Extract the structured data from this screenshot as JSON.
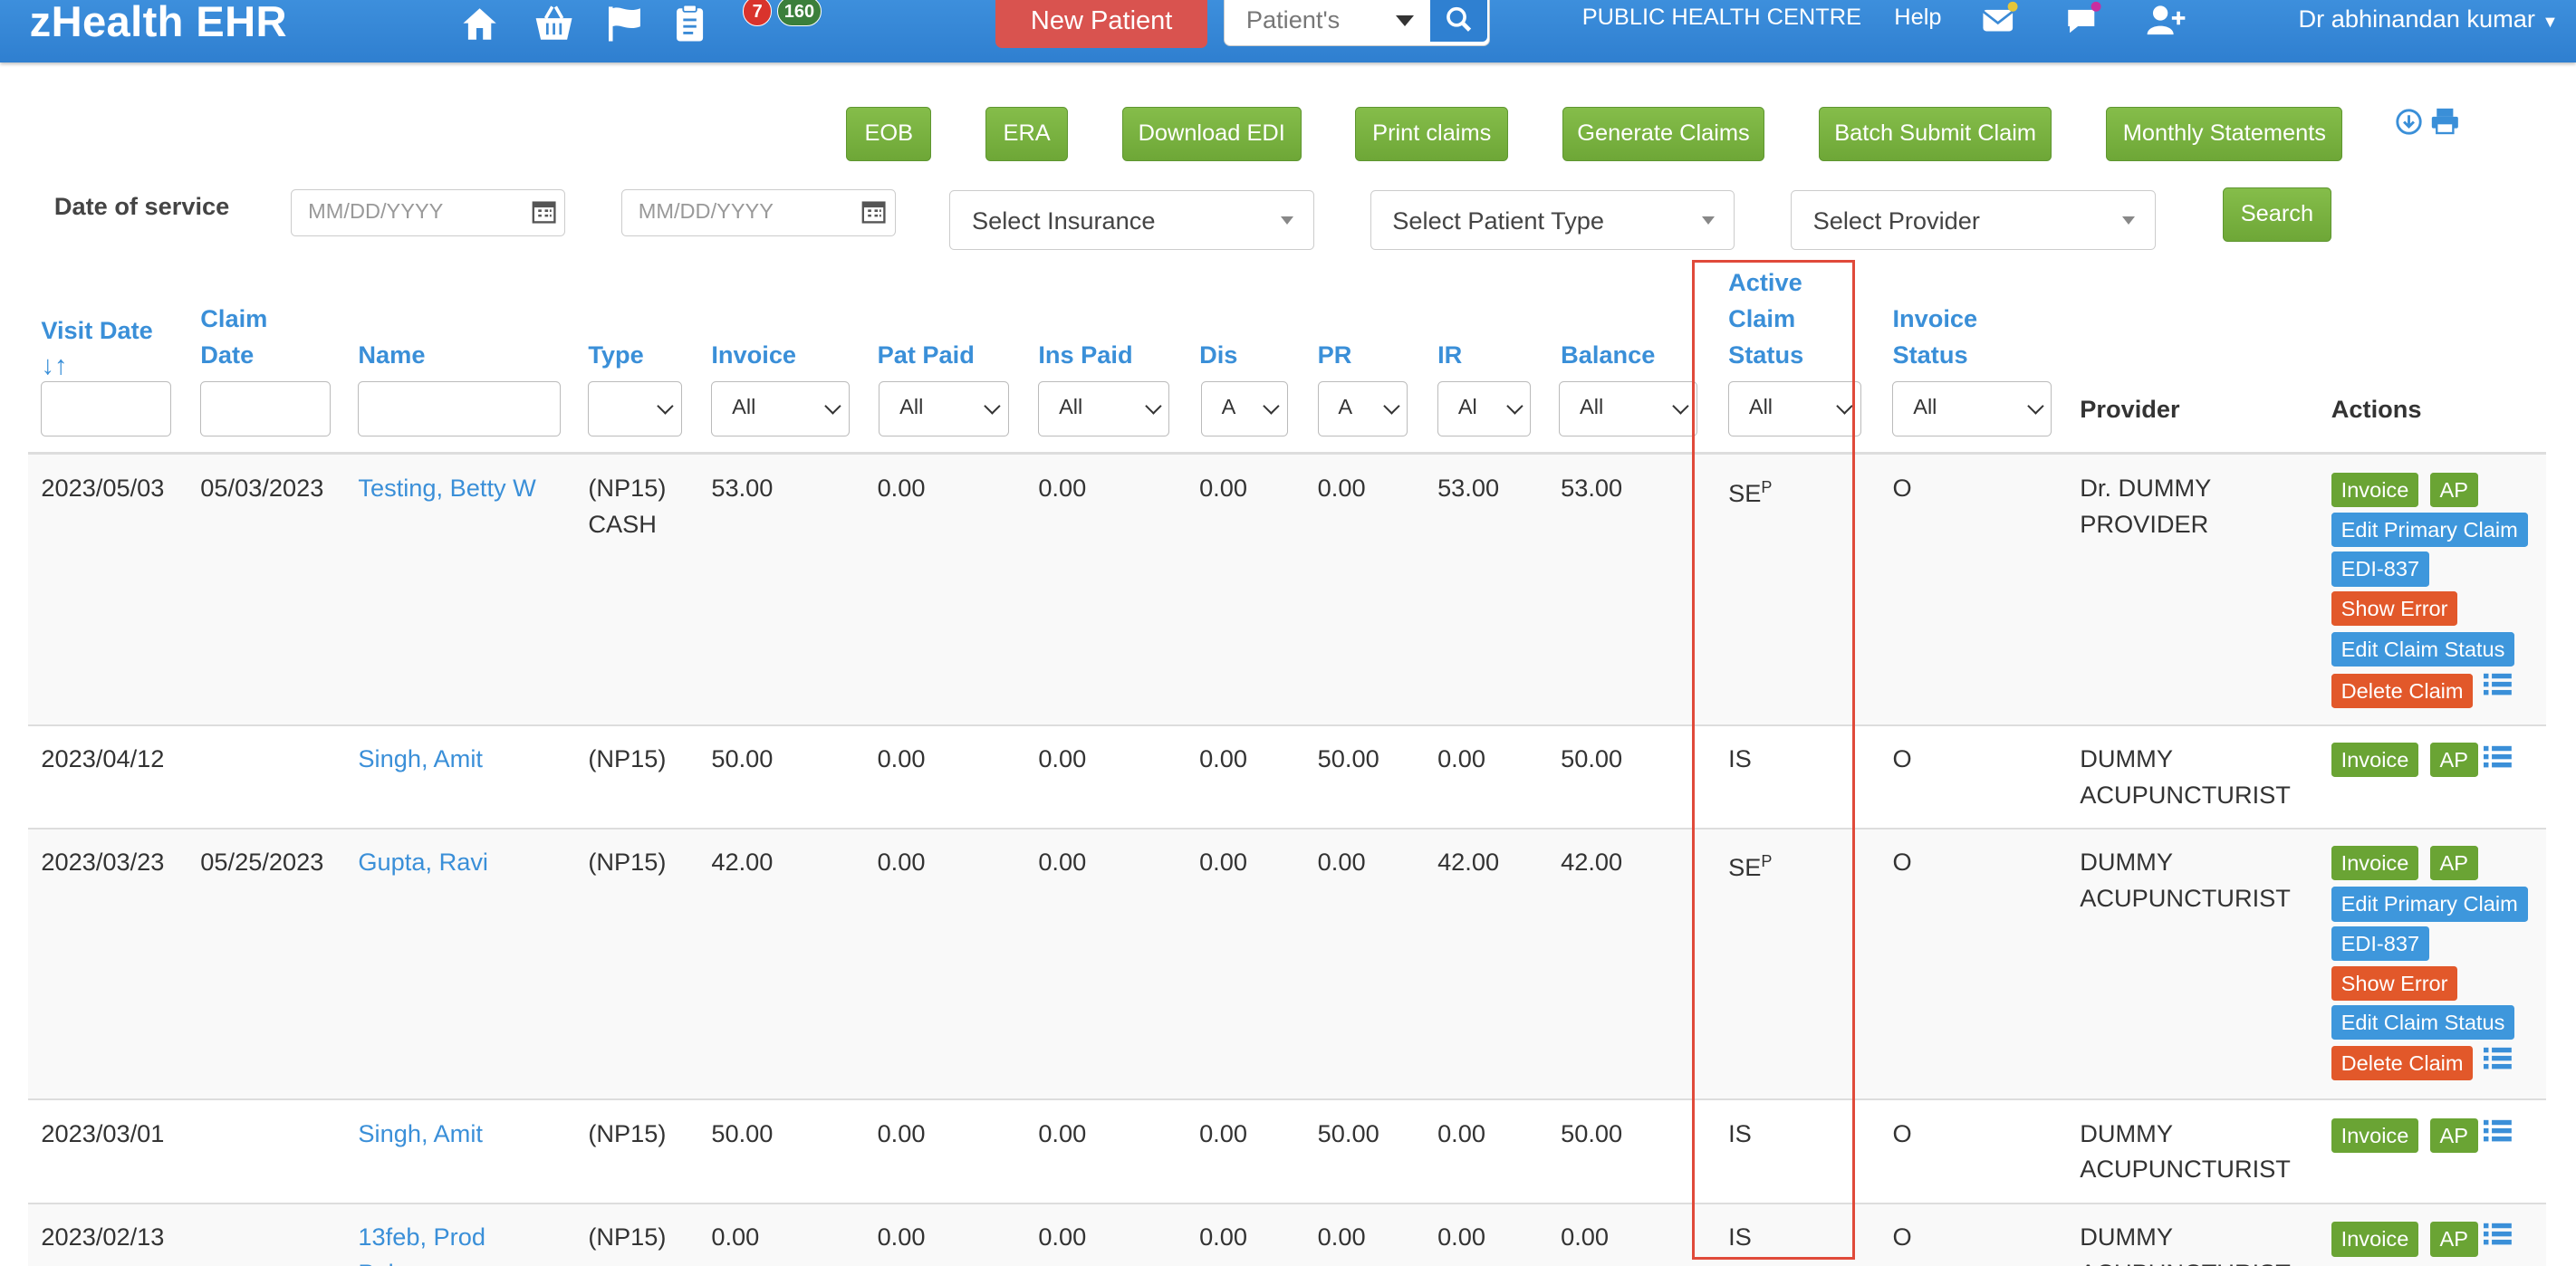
{
  "navbar": {
    "brand": "zHealth EHR",
    "badge_red": "7",
    "badge_green": "160",
    "new_patient_label": "New Patient",
    "patient_search_placeholder": "Patient's",
    "centre": "PUBLIC HEALTH CENTRE",
    "help": "Help",
    "user": "Dr abhinandan kumar"
  },
  "actions": {
    "eob": "EOB",
    "era": "ERA",
    "download_edi": "Download EDI",
    "print_claims": "Print claims",
    "generate_claims": "Generate Claims",
    "batch_submit": "Batch Submit Claim",
    "monthly_statements": "Monthly Statements"
  },
  "filters": {
    "date_of_service_label": "Date of service",
    "date_placeholder": "MM/DD/YYYY",
    "insurance": "Select Insurance",
    "patient_type": "Select Patient Type",
    "provider": "Select Provider",
    "search": "Search"
  },
  "table": {
    "headers": {
      "visit_date": "Visit Date",
      "claim_date_1": "Claim",
      "claim_date_2": "Date",
      "name": "Name",
      "type": "Type",
      "invoice": "Invoice",
      "pat_paid": "Pat Paid",
      "ins_paid": "Ins Paid",
      "dis": "Dis",
      "pr": "PR",
      "ir": "IR",
      "balance": "Balance",
      "active_1": "Active",
      "active_2": "Claim",
      "active_3": "Status",
      "invoice_status_1": "Invoice",
      "invoice_status_2": "Status",
      "provider": "Provider",
      "actions": "Actions"
    },
    "filter_values": {
      "invoice": "All",
      "pat_paid": "All",
      "ins_paid": "All",
      "dis": "A",
      "pr": "A",
      "ir": "Al",
      "balance": "All",
      "active": "All",
      "invoice_status": "All"
    },
    "rows": [
      {
        "visit": "2023/05/03",
        "claim": "05/03/2023",
        "name": "Testing, Betty W",
        "type1": "(NP15)",
        "type2": "CASH",
        "invoice": "53.00",
        "pat_paid": "0.00",
        "ins_paid": "0.00",
        "dis": "0.00",
        "pr": "0.00",
        "ir": "53.00",
        "balance": "53.00",
        "status": "SE",
        "status_sup": "P",
        "inv_status": "O",
        "provider1": "Dr. DUMMY",
        "provider2": "PROVIDER"
      },
      {
        "visit": "2023/04/12",
        "claim": "",
        "name": "Singh, Amit",
        "type1": "(NP15)",
        "type2": "",
        "invoice": "50.00",
        "pat_paid": "0.00",
        "ins_paid": "0.00",
        "dis": "0.00",
        "pr": "50.00",
        "ir": "0.00",
        "balance": "50.00",
        "status": "IS",
        "status_sup": "",
        "inv_status": "O",
        "provider1": "DUMMY",
        "provider2": "ACUPUNCTURIST"
      },
      {
        "visit": "2023/03/23",
        "claim": "05/25/2023",
        "name": "Gupta, Ravi",
        "type1": "(NP15)",
        "type2": "",
        "invoice": "42.00",
        "pat_paid": "0.00",
        "ins_paid": "0.00",
        "dis": "0.00",
        "pr": "0.00",
        "ir": "42.00",
        "balance": "42.00",
        "status": "SE",
        "status_sup": "P",
        "inv_status": "O",
        "provider1": "DUMMY",
        "provider2": "ACUPUNCTURIST"
      },
      {
        "visit": "2023/03/01",
        "claim": "",
        "name": "Singh, Amit",
        "type1": "(NP15)",
        "type2": "",
        "invoice": "50.00",
        "pat_paid": "0.00",
        "ins_paid": "0.00",
        "dis": "0.00",
        "pr": "50.00",
        "ir": "0.00",
        "balance": "50.00",
        "status": "IS",
        "status_sup": "",
        "inv_status": "O",
        "provider1": "DUMMY",
        "provider2": "ACUPUNCTURIST"
      },
      {
        "visit": "2023/02/13",
        "claim": "",
        "name": "13feb, Prod",
        "name2": "Pal",
        "type1": "(NP15)",
        "type2": "",
        "invoice": "0.00",
        "pat_paid": "0.00",
        "ins_paid": "0.00",
        "dis": "0.00",
        "pr": "0.00",
        "ir": "0.00",
        "balance": "0.00",
        "status": "IS",
        "status_sup": "",
        "inv_status": "O",
        "provider1": "DUMMY",
        "provider2": "ACUPUNCTURIST"
      }
    ],
    "row_actions": {
      "invoice": "Invoice",
      "ap": "AP",
      "edit_primary": "Edit Primary Claim",
      "edi": "EDI-837",
      "show_error": "Show Error",
      "edit_status": "Edit Claim Status",
      "delete": "Delete Claim"
    }
  }
}
